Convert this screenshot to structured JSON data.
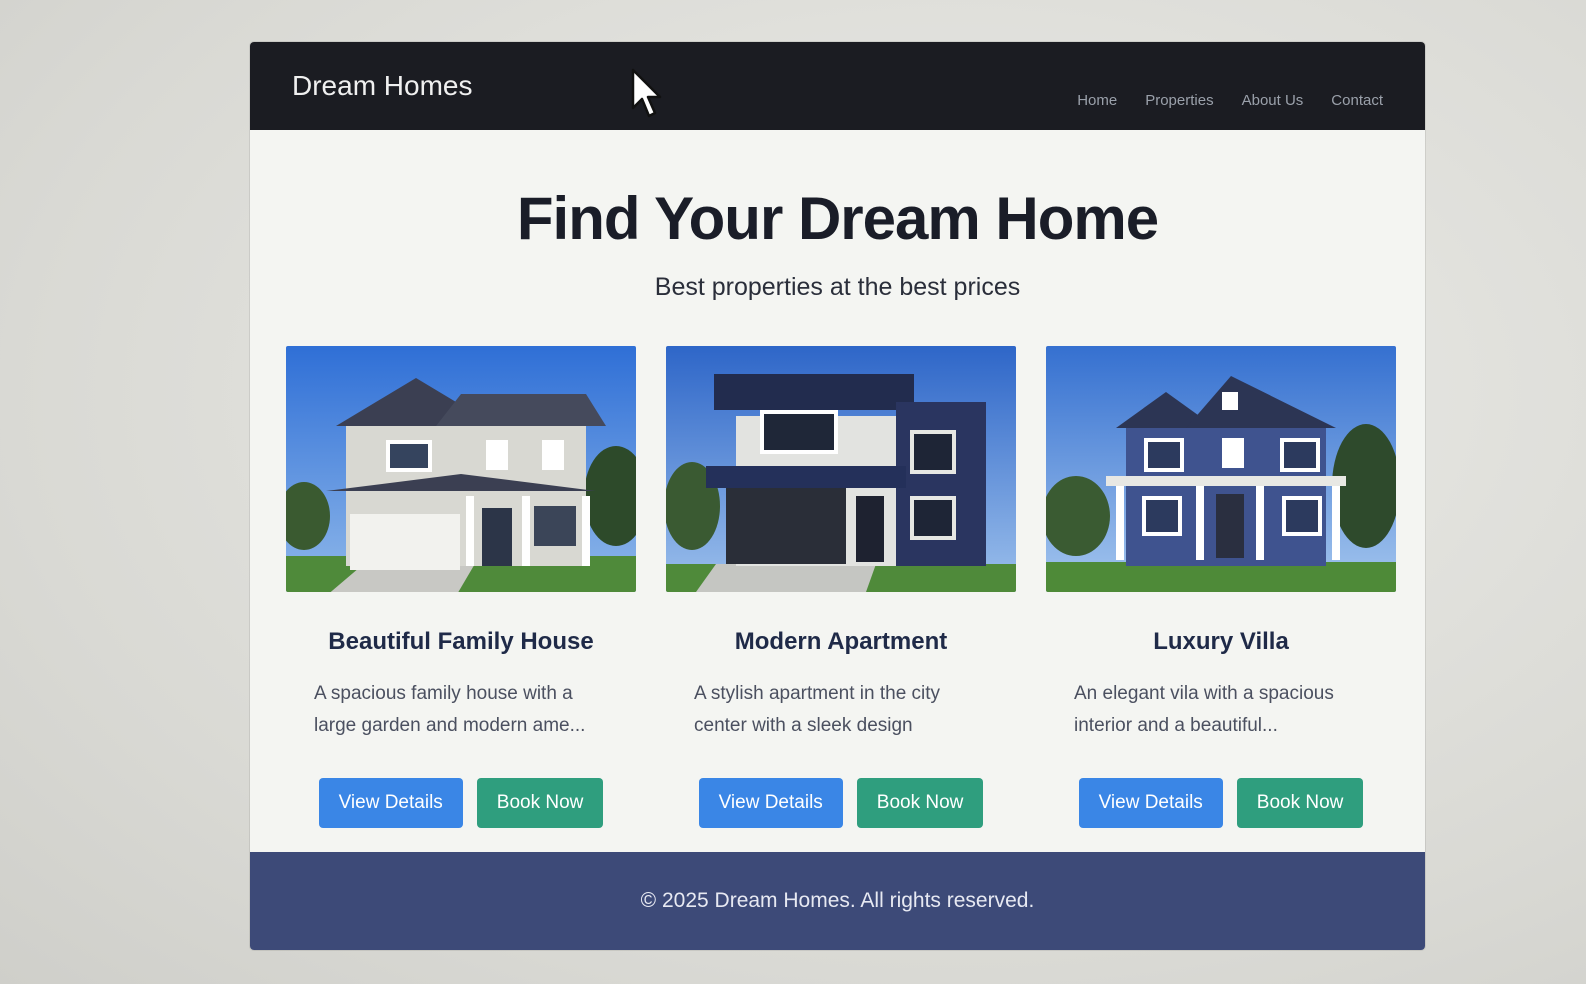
{
  "navbar": {
    "brand": "Dream Homes",
    "links": [
      "Home",
      "Properties",
      "About Us",
      "Contact"
    ]
  },
  "hero": {
    "title": "Find Your Dream Home",
    "subtitle": "Best properties at the best prices"
  },
  "cards": [
    {
      "title": "Beautiful Family House",
      "description": "A spacious family house with a large garden and modern ame...",
      "primary_label": "View Details",
      "secondary_label": "Book Now"
    },
    {
      "title": "Modern Apartment",
      "description": "A stylish apartment in the city center with a sleek design",
      "primary_label": "View Details",
      "secondary_label": "Book Now"
    },
    {
      "title": "Luxury Villa",
      "description": "An elegant vila with a spacious interior and a beautiful...",
      "primary_label": "View Details",
      "secondary_label": "Book Now"
    }
  ],
  "footer": {
    "text": "© 2025 Dream Homes. All rights reserved."
  },
  "colors": {
    "navbar": "#1b1c22",
    "primary_button": "#3a86e6",
    "secondary_button": "#2f9e7e",
    "footer": "#3d4a78"
  }
}
